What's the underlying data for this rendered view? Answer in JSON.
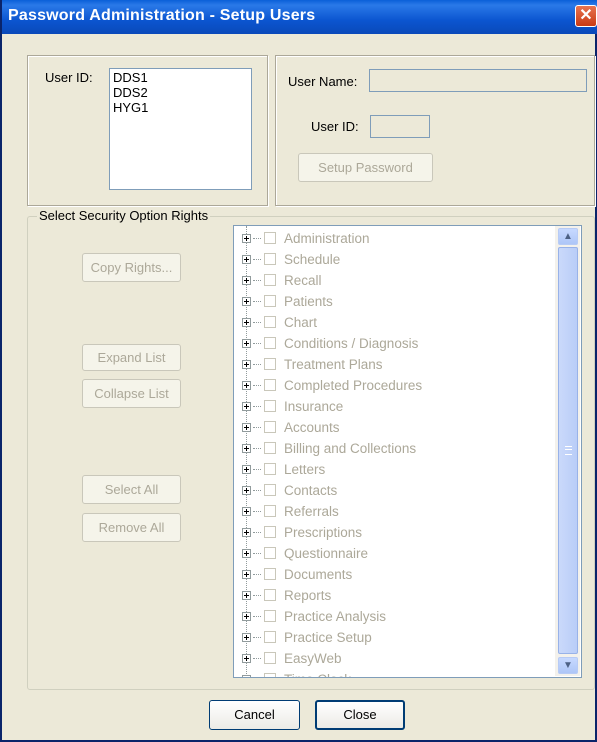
{
  "window": {
    "title": "Password Administration - Setup Users",
    "close_glyph": "✕"
  },
  "left_panel": {
    "user_id_label": "User ID:",
    "users": [
      "DDS1",
      "DDS2",
      "HYG1"
    ]
  },
  "right_panel": {
    "user_name_label": "User Name:",
    "user_name_value": "",
    "user_id_label": "User ID:",
    "user_id_value": "",
    "setup_password_label": "Setup Password"
  },
  "security": {
    "group_title": "Select Security Option Rights",
    "copy_rights_label": "Copy Rights...",
    "expand_list_label": "Expand List",
    "collapse_list_label": "Collapse List",
    "select_all_label": "Select All",
    "remove_all_label": "Remove All",
    "items": [
      "Administration",
      "Schedule",
      "Recall",
      "Patients",
      "Chart",
      "Conditions / Diagnosis",
      "Treatment Plans",
      "Completed Procedures",
      "Insurance",
      "Accounts",
      "Billing and Collections",
      "Letters",
      "Contacts",
      "Referrals",
      "Prescriptions",
      "Questionnaire",
      "Documents",
      "Reports",
      "Practice Analysis",
      "Practice Setup",
      "EasyWeb",
      "Time Clock"
    ]
  },
  "footer": {
    "cancel_label": "Cancel",
    "close_label": "Close"
  }
}
